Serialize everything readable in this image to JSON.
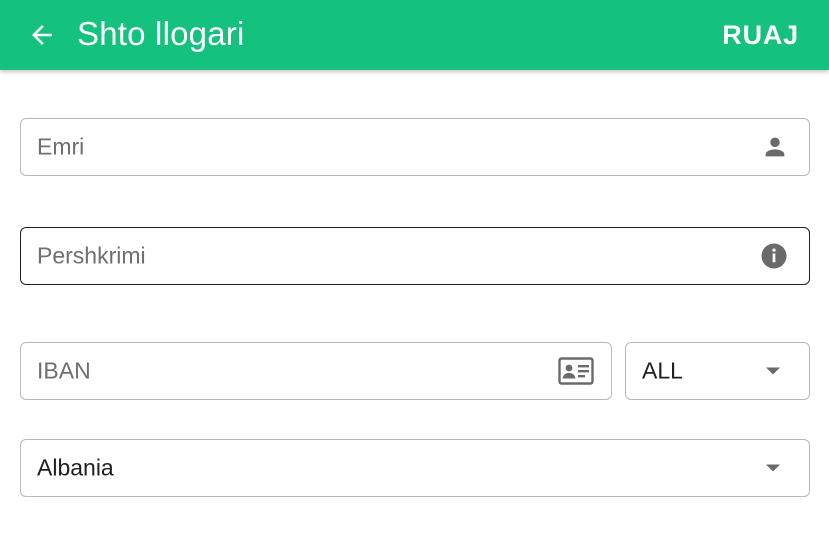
{
  "header": {
    "title": "Shto llogari",
    "save_label": "RUAJ",
    "back_icon": "arrow-back-icon",
    "background": "#14c17d"
  },
  "form": {
    "name": {
      "placeholder": "Emri",
      "value": "",
      "icon": "person-icon"
    },
    "description": {
      "placeholder": "Pershkrimi",
      "value": "",
      "icon": "info-icon",
      "focused": true
    },
    "iban": {
      "placeholder": "IBAN",
      "value": "",
      "icon": "id-card-icon"
    },
    "currency": {
      "selected": "ALL",
      "icon": "dropdown-caret-icon"
    },
    "country": {
      "selected": "Albania",
      "icon": "dropdown-caret-icon"
    }
  }
}
